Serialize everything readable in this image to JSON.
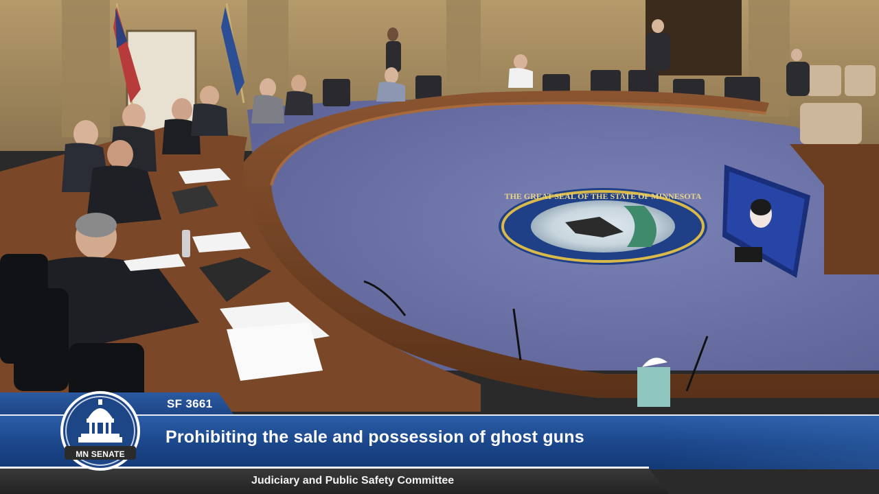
{
  "broadcast": {
    "bill_number": "SF 3661",
    "bill_title": "Prohibiting the sale and possession of ghost guns",
    "committee": "Judiciary and Public Safety Committee",
    "logo_text": "MN SENATE"
  },
  "scene": {
    "floor_seal_text": "THE GREAT SEAL OF THE STATE OF MINNESOTA"
  },
  "colors": {
    "banner_blue": "#1d4687",
    "banner_dark": "#222222",
    "floor_blue": "#6f76a8",
    "wood": "#6a3d22"
  }
}
